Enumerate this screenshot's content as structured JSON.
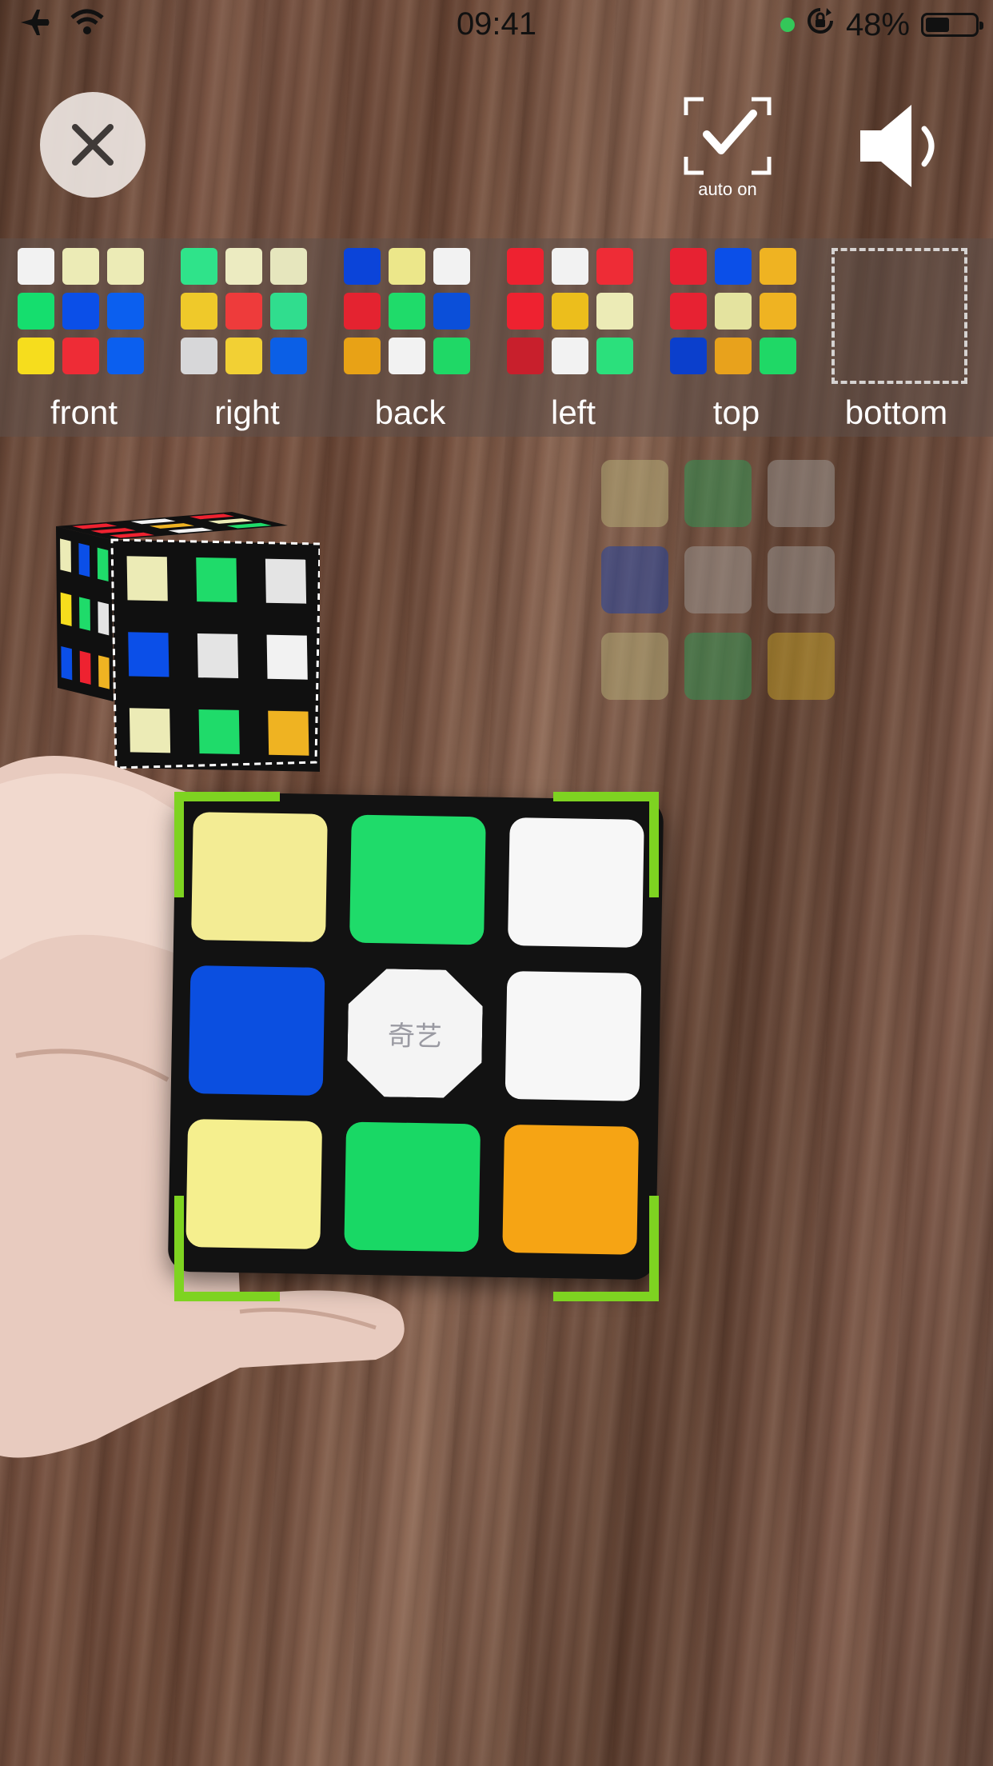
{
  "status_bar": {
    "time": "09:41",
    "battery": "48%",
    "battery_level": 0.48,
    "icons": [
      "airplane-icon",
      "wifi-icon",
      "camera-in-use-dot",
      "rotation-lock-icon",
      "battery-icon"
    ]
  },
  "controls": {
    "close": "close-icon",
    "auto_label": "auto on",
    "auto": "auto-capture-check-icon",
    "sound": "speaker-icon"
  },
  "faces": [
    {
      "label": "front",
      "colors": [
        "#f2f2f2",
        "#ecebb6",
        "#ecebb6",
        "#15de6e",
        "#0b4fe8",
        "#0b5fef",
        "#f6dd1d",
        "#ee2c36",
        "#0b5fef"
      ]
    },
    {
      "label": "right",
      "colors": [
        "#2fe38a",
        "#ecebc1",
        "#e6e6bd",
        "#efc92a",
        "#ee3b3b",
        "#30dd8e",
        "#d7d7d9",
        "#f2d034",
        "#0b5fe6"
      ]
    },
    {
      "label": "back",
      "colors": [
        "#0b44d9",
        "#ece78a",
        "#f2f2f2",
        "#e42330",
        "#1fdb6a",
        "#0b4fd9",
        "#e8a216",
        "#f2f2f2",
        "#1fd866"
      ]
    },
    {
      "label": "left",
      "colors": [
        "#ee2230",
        "#f2f2f2",
        "#ee2c36",
        "#ee2230",
        "#ecbe1c",
        "#ecebb6",
        "#c81f2c",
        "#f2f2f2",
        "#2be07c"
      ]
    },
    {
      "label": "top",
      "colors": [
        "#e72232",
        "#0b4fe8",
        "#efb322",
        "#e72232",
        "#e4e39f",
        "#efb322",
        "#0b3fcc",
        "#e8a21c",
        "#1fd866"
      ]
    },
    {
      "label": "bottom",
      "colors": []
    }
  ],
  "ghost_guide": {
    "colors": [
      "#b8b27a",
      "#2e9a55",
      "#9d9a96",
      "#1a3fa6",
      "#9d9a96",
      "#9d9a96",
      "#b8b27a",
      "#2e9a55",
      "#c8a42a"
    ]
  },
  "preview_cube": {
    "front": [
      "#ecebb6",
      "#1fdb6a",
      "#e4e4e4",
      "#0b4fe8",
      "#e4e4e4",
      "#f2f2f2",
      "#ecebb6",
      "#1fdb6a",
      "#efb322"
    ],
    "top": [
      "#ee2230",
      "#f2f2f2",
      "#ee2230",
      "#ee2230",
      "#efb322",
      "#ecebb6",
      "#ee2230",
      "#f2f2f2",
      "#1fdb6a"
    ],
    "left": [
      "#ecebb6",
      "#0b4fe8",
      "#1fdb6a",
      "#f6dd1d",
      "#1fdb6a",
      "#e4e4e4",
      "#0b4fe8",
      "#ee2230",
      "#efb322"
    ]
  },
  "camera_cube": {
    "colors": [
      "#f3ec94",
      "#1fdb6a",
      "#f7f7f7",
      "#0b4fe0",
      "#f4f4f4",
      "#f7f7f7",
      "#f5ef8e",
      "#19d865",
      "#f6a414"
    ],
    "center_logo": "奇艺"
  }
}
